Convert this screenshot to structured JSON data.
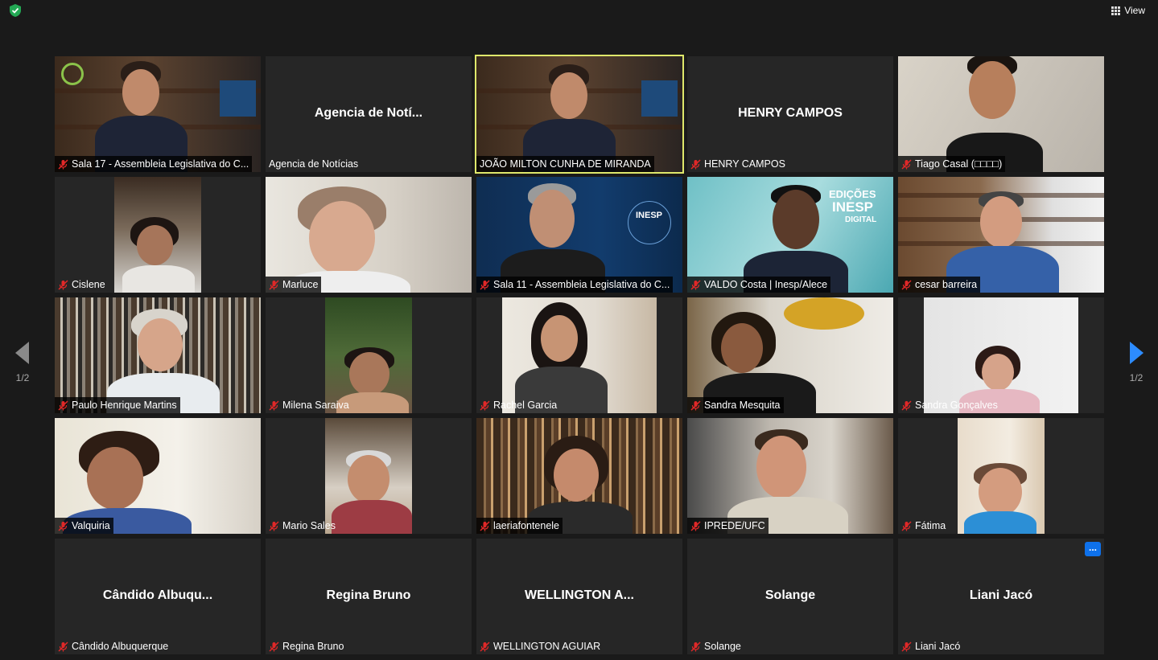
{
  "toolbar": {
    "view_label": "View"
  },
  "pagination": {
    "left_label": "1/2",
    "right_label": "1/2"
  },
  "tiles": [
    {
      "name": "Sala 17 - Assembleia Legislativa do C..."
    },
    {
      "name": "Agencia de Notícias",
      "display": "Agencia de Notí..."
    },
    {
      "name": "JOÃO MILTON CUNHA DE MIRANDA"
    },
    {
      "name": "HENRY CAMPOS",
      "display": "HENRY CAMPOS"
    },
    {
      "name": "Tiago Casal (□□□□)"
    },
    {
      "name": "Cislene"
    },
    {
      "name": "Marluce"
    },
    {
      "name": "Sala 11 - Assembleia Legislativa do C..."
    },
    {
      "name": "VALDO Costa | Inesp/Alece"
    },
    {
      "name": "cesar barreira"
    },
    {
      "name": "Paulo Henrique Martins"
    },
    {
      "name": "Milena Saraiva"
    },
    {
      "name": "Rachel Garcia"
    },
    {
      "name": "Sandra Mesquita"
    },
    {
      "name": "Sandra Gonçalves"
    },
    {
      "name": "Valquiria"
    },
    {
      "name": "Mario Sales"
    },
    {
      "name": "laeriafontenele"
    },
    {
      "name": "IPREDE/UFC"
    },
    {
      "name": "Fátima"
    },
    {
      "name": "Cândido Albuquerque",
      "display": "Cândido  Albuqu..."
    },
    {
      "name": "Regina Bruno",
      "display": "Regina Bruno"
    },
    {
      "name": "WELLINGTON AGUIAR",
      "display": "WELLINGTON  A..."
    },
    {
      "name": "Solange",
      "display": "Solange"
    },
    {
      "name": "Liani Jacó",
      "display": "Liani Jacó"
    }
  ],
  "video_text": {
    "inesp_logo": "INESP",
    "edicoes": "EDIÇÕES",
    "inesp": "INESP",
    "digital": "DIGITAL"
  },
  "more_button": "...",
  "colors": {
    "active_speaker": "#dfe86b",
    "mute": "#e02828",
    "accent": "#0e71eb"
  }
}
